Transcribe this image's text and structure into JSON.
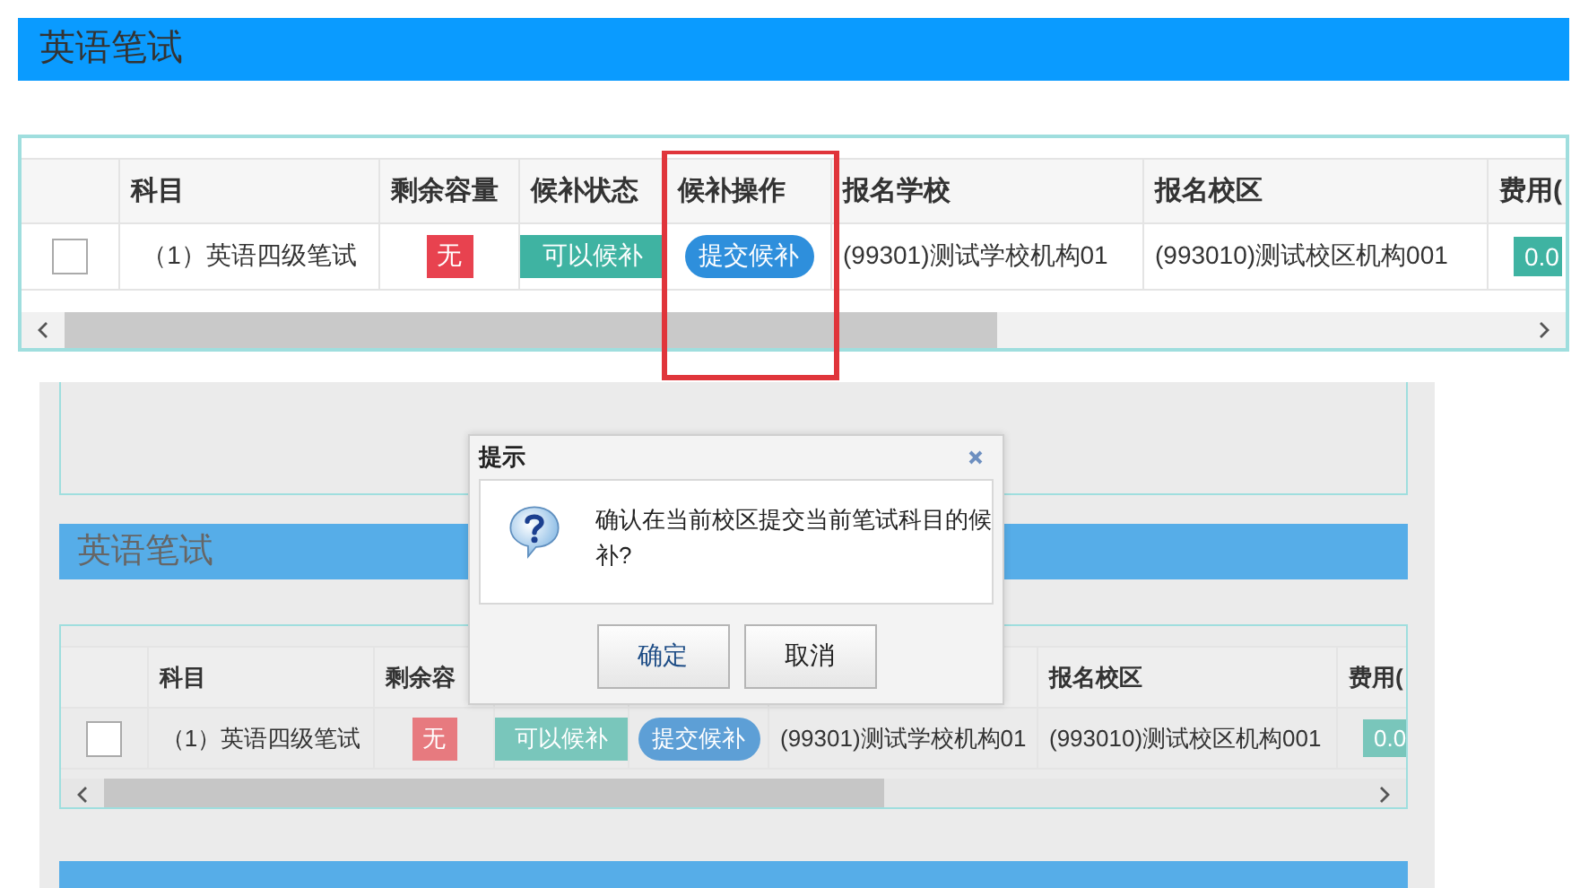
{
  "top": {
    "title": "英语笔试",
    "table": {
      "columns": [
        "科目",
        "剩余容量",
        "候补状态",
        "候补操作",
        "报名学校",
        "报名校区",
        "费用("
      ],
      "rows": [
        {
          "checked": false,
          "subject": "（1）英语四级笔试",
          "capacity": "无",
          "status": "可以候补",
          "action": "提交候补",
          "school": "(99301)测试学校机构01",
          "campus": "(993010)测试校区机构001",
          "fee": "0.0"
        }
      ]
    }
  },
  "lower": {
    "title": "英语笔试",
    "table": {
      "columns_left": [
        "科目",
        "剩余容"
      ],
      "columns_right": [
        "报名校区",
        "费用("
      ],
      "rows": [
        {
          "checked": false,
          "subject": "（1）英语四级笔试",
          "capacity": "无",
          "status": "可以候补",
          "action": "提交候补",
          "school": "(99301)测试学校机构01",
          "campus": "(993010)测试校区机构001",
          "fee": "0.0"
        }
      ]
    }
  },
  "dialog": {
    "title": "提示",
    "message": "确认在当前校区提交当前笔试科目的候补?",
    "buttons": [
      "确定",
      "取消"
    ]
  }
}
